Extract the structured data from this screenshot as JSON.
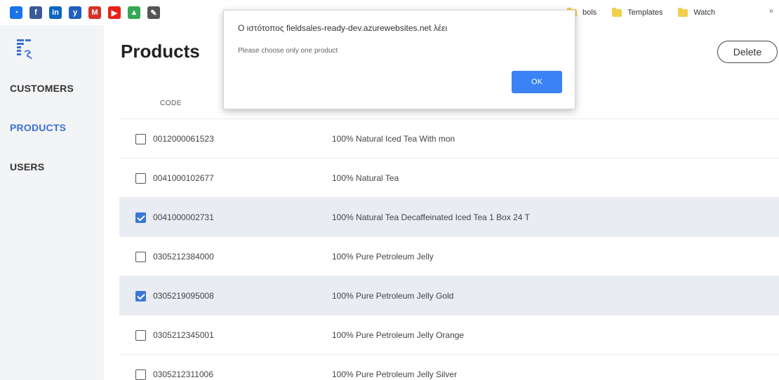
{
  "bookmarks": {
    "folders": [
      "bols",
      "Templates",
      "Watch"
    ],
    "more": "»",
    "icons": [
      {
        "name": "sync-icon",
        "color": "#1a73e8",
        "glyph": "◔"
      },
      {
        "name": "facebook-icon",
        "color": "#3b5998",
        "glyph": "f"
      },
      {
        "name": "linkedin-icon",
        "color": "#0a66c2",
        "glyph": "in"
      },
      {
        "name": "yammer-icon",
        "color": "#1f5fbd",
        "glyph": "y"
      },
      {
        "name": "gmail-icon",
        "color": "#d93025",
        "glyph": "M"
      },
      {
        "name": "youtube-icon",
        "color": "#e62117",
        "glyph": "▶"
      },
      {
        "name": "drive-icon",
        "color": "#34a853",
        "glyph": "▲"
      },
      {
        "name": "tools-icon",
        "color": "#555555",
        "glyph": "✎"
      }
    ]
  },
  "sidebar": {
    "items": [
      {
        "label": "CUSTOMERS",
        "active": false
      },
      {
        "label": "PRODUCTS",
        "active": true
      },
      {
        "label": "USERS",
        "active": false
      }
    ]
  },
  "main": {
    "title": "Products",
    "delete_label": "Delete"
  },
  "table": {
    "headers": {
      "code": "CODE"
    },
    "rows": [
      {
        "code": "0012000061523",
        "name": "100% Natural Iced Tea With mon",
        "checked": false
      },
      {
        "code": "0041000102677",
        "name": "100% Natural Tea",
        "checked": false
      },
      {
        "code": "0041000002731",
        "name": "100% Natural Tea Decaffeinated Iced Tea 1 Box 24 T",
        "checked": true
      },
      {
        "code": "0305212384000",
        "name": "100% Pure Petroleum Jelly",
        "checked": false
      },
      {
        "code": "0305219095008",
        "name": "100% Pure Petroleum Jelly Gold",
        "checked": true
      },
      {
        "code": "0305212345001",
        "name": "100% Pure Petroleum Jelly Orange",
        "checked": false
      },
      {
        "code": "0305212311006",
        "name": "100% Pure Petroleum Jelly Silver",
        "checked": false
      }
    ]
  },
  "dialog": {
    "title": "Ο ιστότοπος fieldsales-ready-dev.azurewebsites.net λέει",
    "message": "Please choose only one product",
    "ok_label": "OK"
  },
  "colors": {
    "accent": "#3a6fd8",
    "ok_button": "#3b82f6",
    "selected_row": "#e9ecf2",
    "sidebar_bg": "#f3f4f6"
  }
}
